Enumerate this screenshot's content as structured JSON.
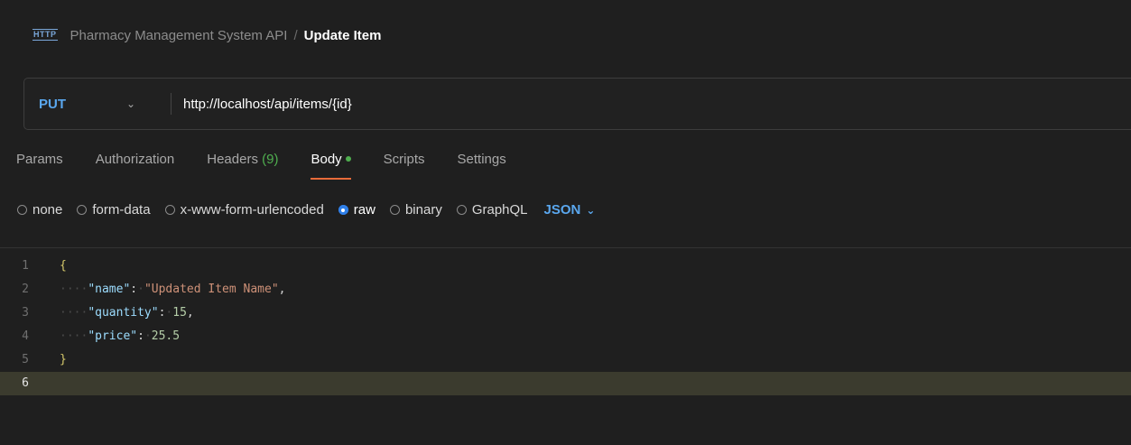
{
  "header": {
    "icon": "http-icon",
    "icon_text": "HTTP",
    "collection": "Pharmacy Management System API",
    "separator": "/",
    "request_name": "Update Item"
  },
  "request": {
    "method": "PUT",
    "url": "http://localhost/api/items/{id}"
  },
  "tabs": [
    {
      "label": "Params"
    },
    {
      "label": "Authorization"
    },
    {
      "label": "Headers",
      "count": "(9)"
    },
    {
      "label": "Body",
      "active": true
    },
    {
      "label": "Scripts"
    },
    {
      "label": "Settings"
    }
  ],
  "body_types": [
    {
      "label": "none",
      "checked": false
    },
    {
      "label": "form-data",
      "checked": false
    },
    {
      "label": "x-www-form-urlencoded",
      "checked": false
    },
    {
      "label": "raw",
      "checked": true
    },
    {
      "label": "binary",
      "checked": false
    },
    {
      "label": "GraphQL",
      "checked": false
    }
  ],
  "format": "JSON",
  "editor": {
    "line_numbers": [
      "1",
      "2",
      "3",
      "4",
      "5",
      "6"
    ],
    "current_line": "6",
    "open_brace": "{",
    "close_brace": "}",
    "fields": [
      {
        "key": "\"name\"",
        "value": "\"Updated Item Name\"",
        "trailing": ","
      },
      {
        "key": "\"quantity\"",
        "value": "15",
        "trailing": ","
      },
      {
        "key": "\"price\"",
        "value": "25.5",
        "trailing": ""
      }
    ]
  },
  "colors": {
    "method": "#5aa7ee",
    "active_tab_underline": "#e86b3a",
    "body_dot": "#4fae4f",
    "radio_checked": "#2f7fe8",
    "current_line_bg": "#3b3b2e"
  }
}
